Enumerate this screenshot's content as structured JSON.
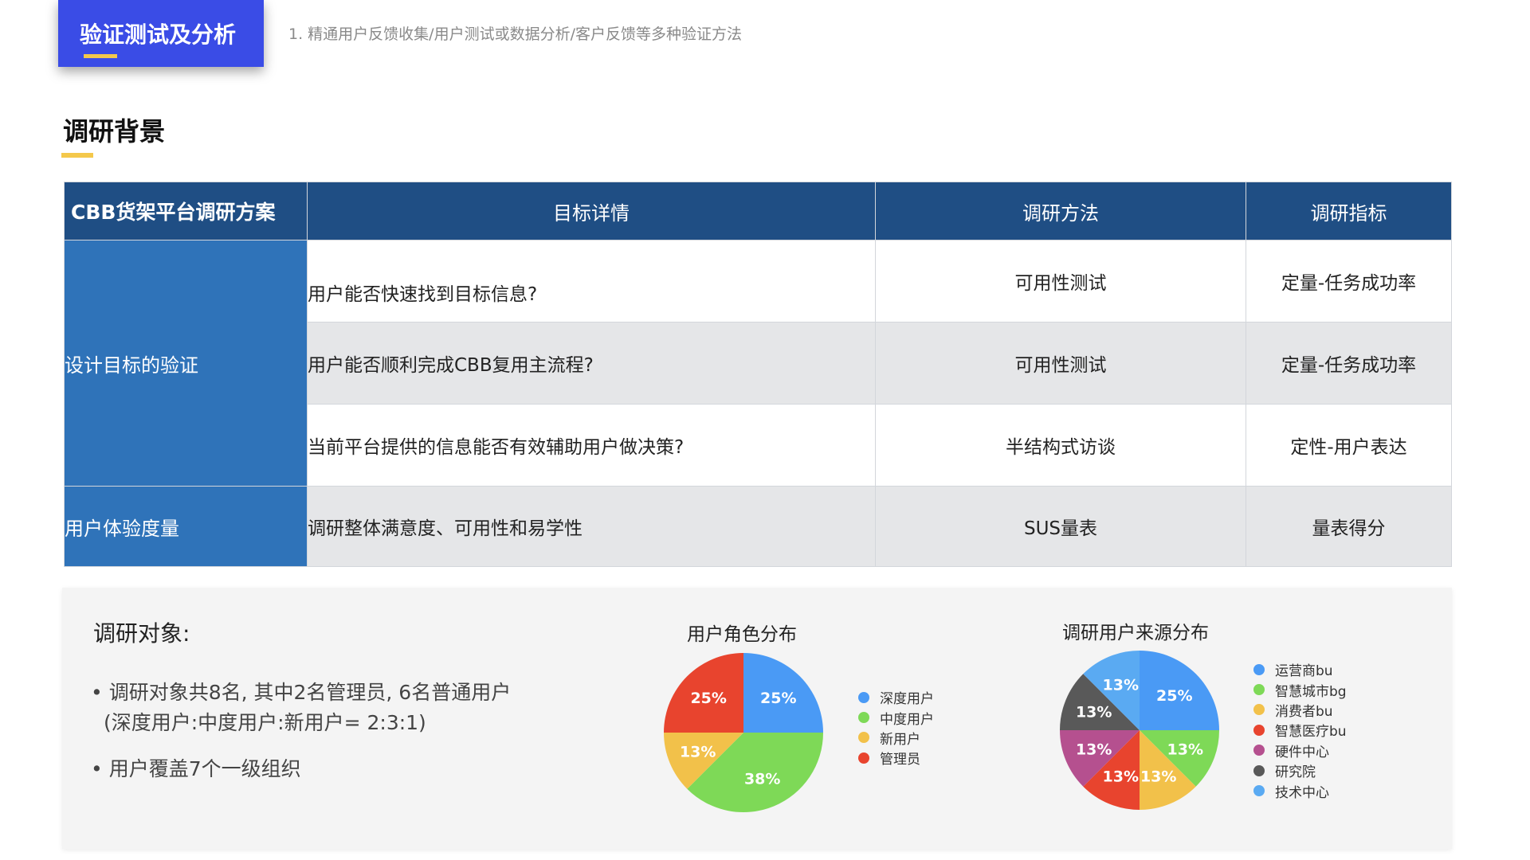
{
  "header": {
    "tag_title": "验证测试及分析",
    "subtitle": "1. 精通用户反馈收集/用户测试或数据分析/客户反馈等多种验证方法",
    "accent_color": "#3a4ce6",
    "highlight_color": "#f4c84b"
  },
  "section": {
    "title": "调研背景"
  },
  "table": {
    "headers": [
      "CBB货架平台调研方案",
      "目标详情",
      "调研方法",
      "调研指标"
    ],
    "groups": [
      {
        "label": "设计目标的验证",
        "rows": [
          {
            "detail": "用户能否快速找到目标信息?",
            "method": "可用性测试",
            "metric": "定量-任务成功率"
          },
          {
            "detail": "用户能否顺利完成CBB复用主流程?",
            "method": "可用性测试",
            "metric": "定量-任务成功率"
          },
          {
            "detail": "当前平台提供的信息能否有效辅助用户做决策?",
            "method": "半结构式访谈",
            "metric": "定性-用户表达"
          }
        ]
      },
      {
        "label": "用户体验度量",
        "rows": [
          {
            "detail": "调研整体满意度、可用性和易学性",
            "method": "SUS量表",
            "metric": "量表得分"
          }
        ]
      }
    ],
    "header_color": "#1f4e84",
    "group_color": "#2f73b9"
  },
  "research": {
    "title": "调研对象:",
    "bullet1_line1": "调研对象共8名, 其中2名管理员, 6名普通用户",
    "bullet1_line2": "(深度用户:中度用户:新用户= 2:3:1)",
    "bullet2": "用户覆盖7个一级组织"
  },
  "chart_data": [
    {
      "type": "pie",
      "title": "用户角色分布",
      "labels": [
        "深度用户",
        "中度用户",
        "新用户",
        "管理员"
      ],
      "values": [
        2,
        3,
        1,
        2
      ],
      "percent_labels": [
        "25%",
        "38%",
        "13%",
        "25%"
      ],
      "colors": [
        "#4a9af5",
        "#7ed957",
        "#f2c14a",
        "#e8442e"
      ],
      "legend": "right"
    },
    {
      "type": "pie",
      "title": "调研用户来源分布",
      "labels": [
        "运营商bu",
        "智慧城市bg",
        "消费者bu",
        "智慧医疗bu",
        "硬件中心",
        "研究院",
        "技术中心"
      ],
      "values": [
        2,
        1,
        1,
        1,
        1,
        1,
        1
      ],
      "percent_labels": [
        "25%",
        "13%",
        "13%",
        "13%",
        "13%",
        "13%",
        "13%"
      ],
      "colors": [
        "#4a9af5",
        "#7ed957",
        "#f2c14a",
        "#e8442e",
        "#b5508f",
        "#595959",
        "#5aaaf2"
      ],
      "legend": "right"
    }
  ]
}
